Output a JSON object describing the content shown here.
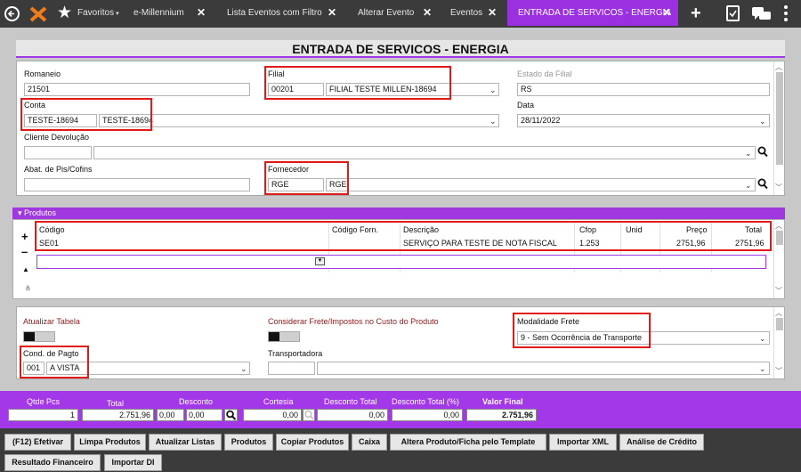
{
  "tabs": {
    "favorites": "Favoritos",
    "items": [
      {
        "label": "e-Millennium"
      },
      {
        "label": "Lista Eventos com Filtro"
      },
      {
        "label": "Alterar Evento"
      },
      {
        "label": "Eventos"
      },
      {
        "label": "ENTRADA DE SERVICOS - ENERGIA"
      }
    ],
    "close": "✕"
  },
  "page": {
    "title": "ENTRADA DE SERVICOS - ENERGIA"
  },
  "form": {
    "romaneio": {
      "label": "Romaneio",
      "value": "21501"
    },
    "filial": {
      "label": "Filial",
      "code": "00201",
      "name": "FILIAL TESTE MILLEN-18694"
    },
    "estado_filial": {
      "label": "Estado da Filial",
      "value": "RS"
    },
    "conta": {
      "label": "Conta",
      "code": "TESTE-18694",
      "name": "TESTE-18694"
    },
    "data": {
      "label": "Data",
      "value": "28/11/2022"
    },
    "cliente_devolucao": {
      "label": "Cliente Devolução",
      "code": "",
      "name": ""
    },
    "abat": {
      "label": "Abat. de Pis/Cofins",
      "value": ""
    },
    "fornecedor": {
      "label": "Fornecedor",
      "code": "RGE",
      "name": "RGE"
    }
  },
  "produtos": {
    "header": "Produtos",
    "columns": [
      "Código",
      "Código Forn.",
      "Descrição",
      "Cfop",
      "Unid",
      "Preço",
      "Total"
    ],
    "rows": [
      {
        "codigo": "SE01",
        "codigo_forn": "",
        "descricao": "SERVIÇO PARA TESTE DE NOTA FISCAL",
        "cfop": "1.253",
        "unid": "",
        "preco": "2751,96",
        "total": "2751,96"
      }
    ]
  },
  "lower": {
    "atualizar_tabela": "Atualizar Tabela",
    "considerar_frete": "Considerar Frete/Impostos no Custo do Produto",
    "modalidade_frete": {
      "label": "Modalidade Frete",
      "value": "9 - Sem Ocorrência de Transporte"
    },
    "cond_pagto": {
      "label": "Cond. de Pagto",
      "code": "001",
      "name": "A VISTA"
    },
    "transportadora": {
      "label": "Transportadora",
      "code": "",
      "name": ""
    }
  },
  "totals": {
    "qtde_pcs": {
      "label": "Qtde Pcs",
      "value": "1"
    },
    "total": {
      "label": "Total",
      "value": "2.751,96"
    },
    "desconto": {
      "label": "Desconto",
      "pct": "0,00",
      "value": "0,00"
    },
    "cortesia": {
      "label": "Cortesia",
      "value": "0,00"
    },
    "desconto_total": {
      "label": "Desconto Total",
      "value": "0,00"
    },
    "desconto_total_pct": {
      "label": "Desconto Total (%)",
      "value": "0,00"
    },
    "valor_final": {
      "label": "Valor Final",
      "value": "2.751,96"
    }
  },
  "buttons": [
    "(F12) Efetivar",
    "Limpa Produtos",
    "Atualizar Listas",
    "Produtos",
    "Copiar Produtos",
    "Caixa",
    "Altera Produto/Ficha pelo Template",
    "Importar XML",
    "Análise de Crédito",
    "Resultado Financeiro",
    "Importar DI"
  ],
  "colors": {
    "accent": "#a238e8",
    "highlight": "#e01919",
    "topbar": "#3b3b3b"
  }
}
